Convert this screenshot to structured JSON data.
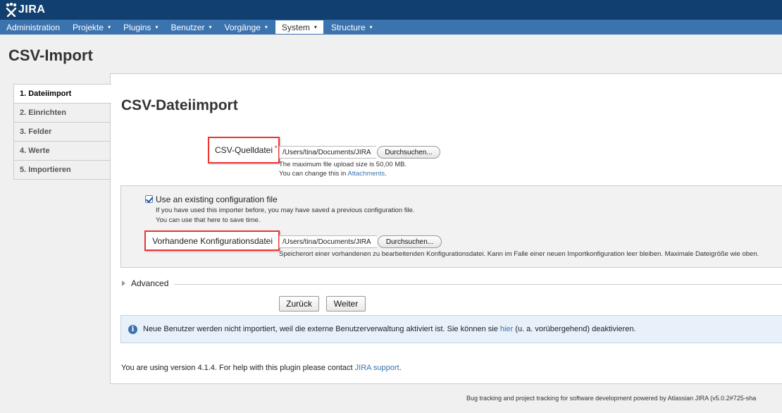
{
  "brand": {
    "name": "JIRA",
    "logo_icon": "jira-logo-icon"
  },
  "nav": {
    "items": [
      {
        "label": "Administration",
        "has_menu": false
      },
      {
        "label": "Projekte",
        "has_menu": true
      },
      {
        "label": "Plugins",
        "has_menu": true
      },
      {
        "label": "Benutzer",
        "has_menu": true
      },
      {
        "label": "Vorgänge",
        "has_menu": true
      },
      {
        "label": "System",
        "has_menu": true,
        "active": true
      },
      {
        "label": "Structure",
        "has_menu": true
      }
    ],
    "caret": "▾"
  },
  "page": {
    "title": "CSV-Import"
  },
  "steps": [
    {
      "label": "1. Dateiimport",
      "active": true
    },
    {
      "label": "2. Einrichten"
    },
    {
      "label": "3. Felder"
    },
    {
      "label": "4. Werte"
    },
    {
      "label": "5. Importieren"
    }
  ],
  "main": {
    "title": "CSV-Dateiimport",
    "source": {
      "label": "CSV-Quelldatei",
      "required_mark": "*",
      "value": "/Users/tina/Documents/JIRA",
      "browse_label": "Durchsuchen...",
      "help_line1": "The maximum file upload size is 50,00 MB.",
      "help_line2_prefix": "You can change this in ",
      "help_line2_link": "Attachments",
      "help_line2_suffix": "."
    },
    "config": {
      "checkbox_label": "Use an existing configuration file",
      "checked": true,
      "help_line1": "If you have used this importer before, you may have saved a previous configuration file.",
      "help_line2": "You can use that here to save time.",
      "file_label": "Vorhandene Konfigurationsdatei",
      "value": "/Users/tina/Documents/JIRA",
      "browse_label": "Durchsuchen...",
      "file_help": "Speicherort einer vorhandenen zu bearbeitenden Konfigurationsdatei. Kann im Falle einer neuen Importkonfiguration leer bleiben. Maximale Dateigröße wie oben."
    },
    "advanced_label": "Advanced",
    "back_label": "Zurück",
    "next_label": "Weiter",
    "info": {
      "icon": "info-icon",
      "text_prefix": "Neue Benutzer werden nicht importiert, weil die externe Benutzerverwaltung aktiviert ist. Sie können sie ",
      "link": "hier",
      "text_suffix": " (u. a. vorübergehend) deaktivieren."
    },
    "version": {
      "prefix": "You are using version 4.1.4. For help with this plugin please contact ",
      "link": "JIRA support",
      "suffix": "."
    }
  },
  "footer": "Bug tracking and project tracking for software development powered by Atlassian JIRA (v5.0.2#725-sha"
}
